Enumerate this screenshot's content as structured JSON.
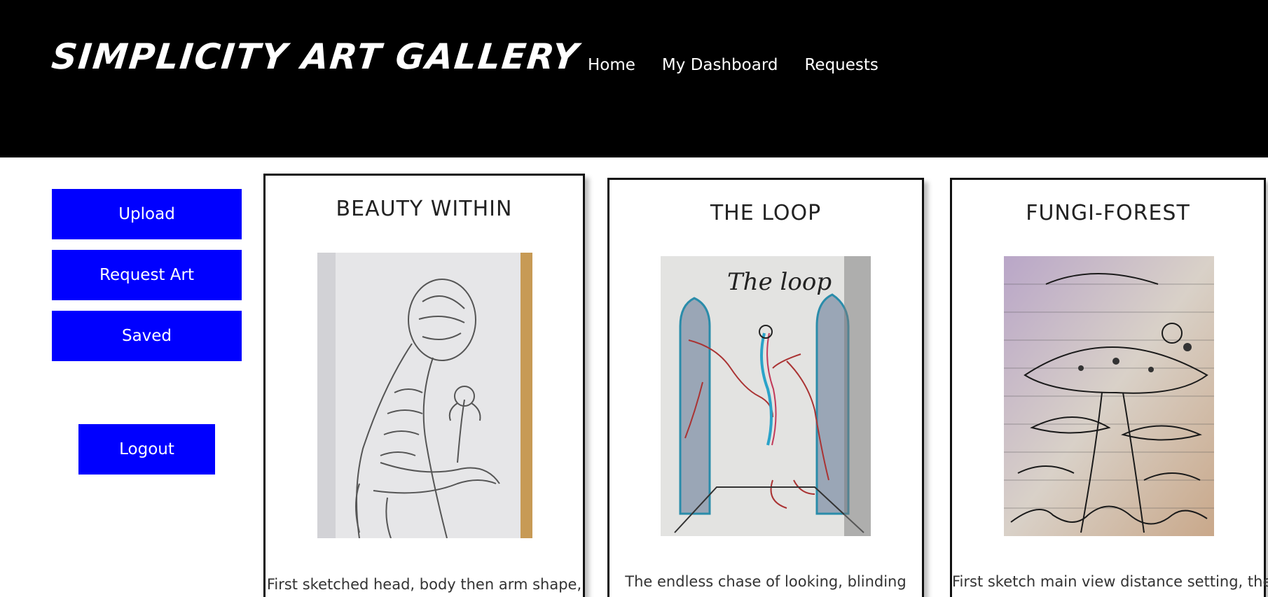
{
  "header": {
    "brand": "SIMPLICITY ART GALLERY",
    "nav": [
      "Home",
      "My Dashboard",
      "Requests"
    ]
  },
  "sidebar": {
    "upload": "Upload",
    "request_art": "Request Art",
    "saved": "Saved",
    "logout": "Logout"
  },
  "cards": [
    {
      "title": "BEAUTY WITHIN",
      "desc": "First sketched head, body then arm shape,"
    },
    {
      "title": "THE LOOP",
      "desc": "The endless chase of looking, blinding",
      "art_caption": "The loop"
    },
    {
      "title": "FUNGI-FOREST",
      "desc": "First sketch main view distance setting, then"
    }
  ],
  "colors": {
    "header_bg": "#000000",
    "button_bg": "#0000ff",
    "text": "#222222"
  }
}
